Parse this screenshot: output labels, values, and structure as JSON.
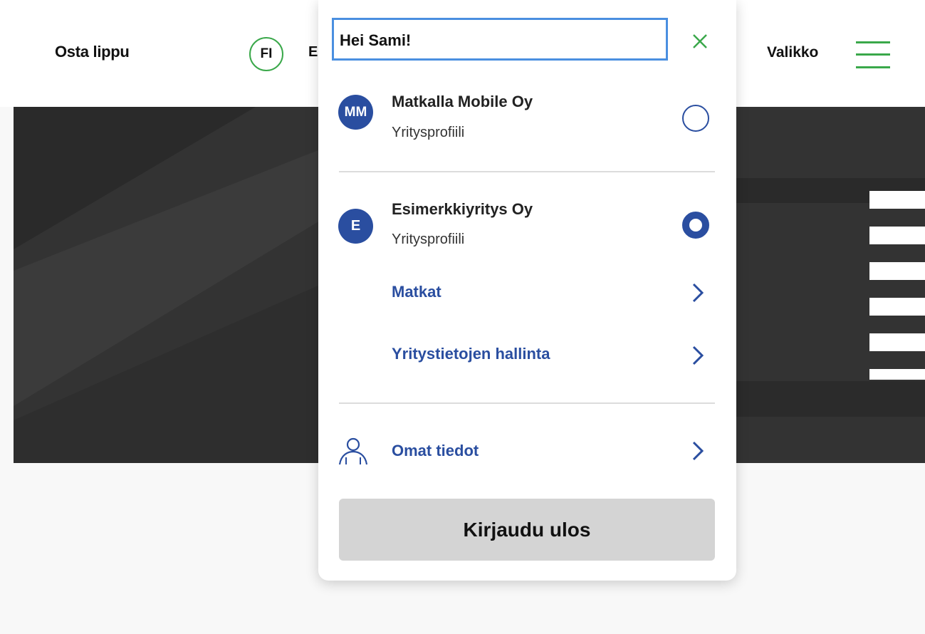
{
  "header": {
    "buy_ticket": "Osta lippu",
    "language": "FI",
    "language_next": "E",
    "menu_label": "Valikko"
  },
  "panel": {
    "greeting": "Hei Sami!",
    "profiles": [
      {
        "initials": "MM",
        "name": "Matkalla Mobile Oy",
        "type": "Yritysprofiili",
        "selected": false
      },
      {
        "initials": "E",
        "name": "Esimerkkiyritys Oy",
        "type": "Yritysprofiili",
        "selected": true,
        "links": [
          "Matkat",
          "Yritystietojen hallinta"
        ]
      }
    ],
    "own_info": "Omat tiedot",
    "logout": "Kirjaudu ulos"
  },
  "icons": {
    "close": "close-icon",
    "menu": "hamburger-menu-icon",
    "person": "person-icon",
    "chevron": "chevron-right-icon",
    "radio": "radio-button"
  },
  "colors": {
    "accent_green": "#3aa84a",
    "brand_blue": "#2a4ea0",
    "focus_blue": "#4a8fe0",
    "hero_dark": "#333333",
    "logout_bg": "#d4d4d4"
  }
}
